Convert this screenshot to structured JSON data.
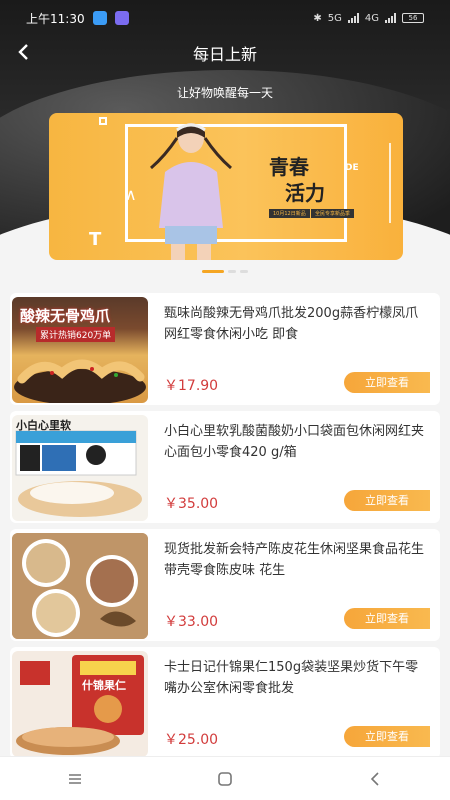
{
  "status_bar": {
    "time": "上午11:30",
    "network_1": "5G",
    "network_2": "4G",
    "battery": "56"
  },
  "header": {
    "back_icon": "back-arrow-icon",
    "title": "每日上新",
    "slogan": "让好物唤醒每一天"
  },
  "banner": {
    "headline_1": "青春",
    "headline_2": "活力",
    "de": "DE",
    "tag_1": "10月12日新品",
    "tag_2": "全民专享新品季",
    "deco_letter": "T",
    "pages": 3,
    "active_page": 0
  },
  "products": [
    {
      "name": "甄味尚酸辣无骨鸡爪批发200g蒜香柠檬凤爪网红零食休闲小吃 即食",
      "price": "￥17.90",
      "button": "立即查看",
      "thumb_caption": "酸辣无骨鸡爪",
      "thumb_sub": "累计热销620万单"
    },
    {
      "name": "小白心里软乳酸菌酸奶小口袋面包休闲网红夹心面包小零食420 g/箱",
      "price": "￥35.00",
      "button": "立即查看",
      "thumb_caption": "小白心里软"
    },
    {
      "name": "现货批发新会特产陈皮花生休闲坚果食品花生带壳零食陈皮味 花生",
      "price": "￥33.00",
      "button": "立即查看"
    },
    {
      "name": "卡士日记什锦果仁150g袋装坚果炒货下午零嘴办公室休闲零食批发",
      "price": "￥25.00",
      "button": "立即查看",
      "thumb_caption": "什锦果仁"
    }
  ],
  "nav_bar": {
    "menu_icon": "menu-icon",
    "home_icon": "home-square-icon",
    "back_icon": "back-triangle-icon"
  },
  "colors": {
    "accent": "#f5a623",
    "price": "#d23c3c",
    "header_bg": "#2a2a2a"
  }
}
